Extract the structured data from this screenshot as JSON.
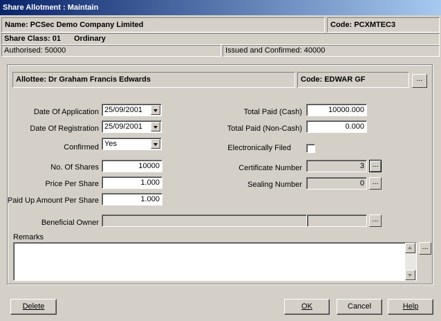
{
  "window": {
    "title": "Share Allotment : Maintain"
  },
  "header": {
    "name": "Name: PCSec Demo Company Limited",
    "code": "Code: PCXMTEC3",
    "share_class_label": "Share Class: 01",
    "share_class_name": "Ordinary",
    "authorised": "Authorised: 50000",
    "issued": "Issued and Confirmed: 40000"
  },
  "allottee": {
    "name": "Allottee: Dr Graham Francis Edwards",
    "code": "Code: EDWAR GF"
  },
  "form": {
    "date_of_application": {
      "label": "Date Of Application",
      "value": "25/09/2001"
    },
    "date_of_registration": {
      "label": "Date Of Registration",
      "value": "25/09/2001"
    },
    "confirmed": {
      "label": "Confirmed",
      "value": "Yes"
    },
    "no_of_shares": {
      "label": "No. Of Shares",
      "value": "10000"
    },
    "price_per_share": {
      "label": "Price Per Share",
      "value": "1.000"
    },
    "paid_up_amount": {
      "label": "Paid Up Amount Per Share",
      "value": "1.000"
    },
    "total_paid_cash": {
      "label": "Total Paid (Cash)",
      "value": "10000.000"
    },
    "total_paid_noncash": {
      "label": "Total Paid (Non-Cash)",
      "value": "0.000"
    },
    "electronically_filed": {
      "label": "Electronically Filed",
      "checked": false
    },
    "certificate_number": {
      "label": "Certificate Number",
      "value": "3"
    },
    "sealing_number": {
      "label": "Sealing Number",
      "value": "0"
    },
    "beneficial_owner": {
      "label": "Beneficial Owner",
      "value": ""
    },
    "remarks": {
      "label": "Remarks",
      "value": ""
    }
  },
  "buttons": {
    "ellipsis": "...",
    "delete": "Delete",
    "ok": "OK",
    "cancel": "Cancel",
    "help": "Help"
  }
}
